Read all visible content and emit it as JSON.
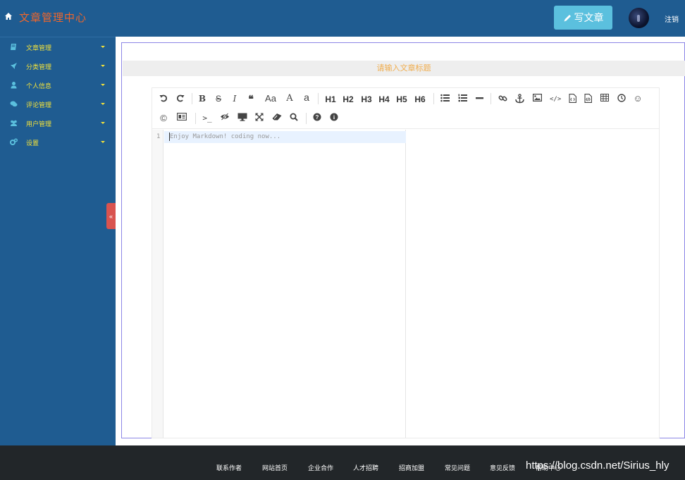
{
  "header": {
    "brand": "文章管理中心",
    "write_button": "写文章",
    "logout": "注销",
    "brand_color": "#f0662b",
    "bar_color": "#1f5c91"
  },
  "sidebar": {
    "items": [
      {
        "label": "文章管理",
        "icon": "book-icon"
      },
      {
        "label": "分类管理",
        "icon": "rocket-icon"
      },
      {
        "label": "个人信息",
        "icon": "user-icon"
      },
      {
        "label": "评论管理",
        "icon": "comments-icon"
      },
      {
        "label": "用户管理",
        "icon": "users-icon"
      },
      {
        "label": "设置",
        "icon": "cogs-icon"
      }
    ],
    "collapse_glyph": "«"
  },
  "editor": {
    "title_placeholder": "请输入文章标题",
    "line_number": "1",
    "code_placeholder": "Enjoy Markdown! coding now...",
    "toolbar": {
      "headings": [
        "H1",
        "H2",
        "H3",
        "H4",
        "H5",
        "H6"
      ],
      "font_a_labels": [
        "Aa",
        "A",
        "a"
      ]
    }
  },
  "footer": {
    "links": [
      "联系作者",
      "网站首页",
      "企业合作",
      "人才招聘",
      "招商加盟",
      "常见问题",
      "意见反馈",
      "帮助中心"
    ],
    "watermark": "https://blog.csdn.net/Sirius_hly"
  }
}
